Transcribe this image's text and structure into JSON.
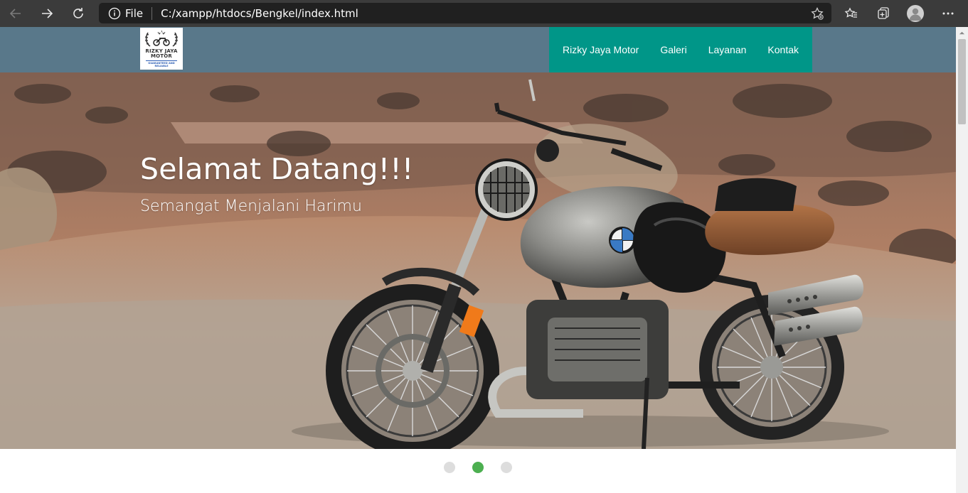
{
  "browser": {
    "address_scheme": "File",
    "address_url": "C:/xampp/htdocs/Bengkel/index.html"
  },
  "navbar": {
    "logo": {
      "line1": "RIZKY JAYA",
      "line2": "MOTOR",
      "tagline1": "GUARANTEED AND",
      "tagline2": "RELIABLE"
    },
    "menu": [
      {
        "label": "Rizky Jaya Motor"
      },
      {
        "label": "Galeri"
      },
      {
        "label": "Layanan"
      },
      {
        "label": "Kontak"
      }
    ],
    "colors": {
      "bar": "#59788a",
      "menu": "#009688"
    }
  },
  "hero": {
    "title": "Selamat Datang!!!",
    "subtitle": "Semangat Menjalani Harimu"
  },
  "slider": {
    "dots": [
      {
        "active": false
      },
      {
        "active": true
      },
      {
        "active": false
      }
    ],
    "active_color": "#4caf50"
  },
  "icons": {
    "back": "arrow-left-icon",
    "forward": "arrow-right-icon",
    "reload": "reload-icon",
    "info": "info-icon",
    "favorite": "star-add-icon",
    "favorites": "favorites-icon",
    "collections": "collections-icon",
    "profile": "avatar-icon",
    "menu": "more-icon"
  }
}
